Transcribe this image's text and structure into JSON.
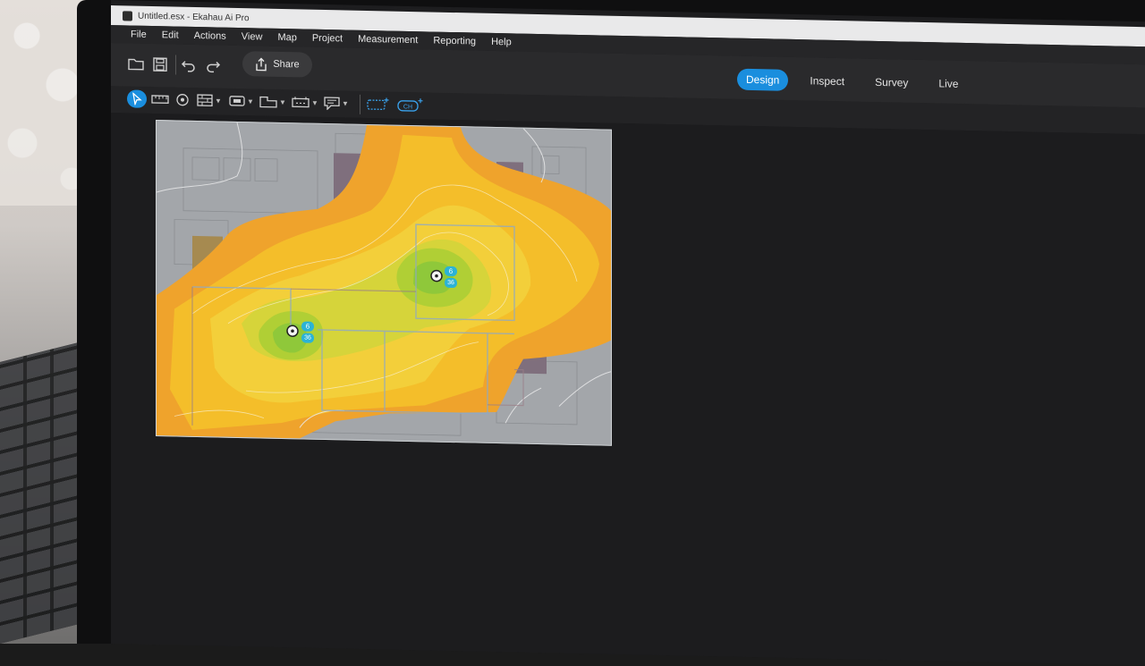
{
  "window": {
    "title": "Untitled.esx - Ekahau Ai Pro"
  },
  "menu": {
    "items": [
      "File",
      "Edit",
      "Actions",
      "View",
      "Map",
      "Project",
      "Measurement",
      "Reporting",
      "Help"
    ]
  },
  "toolbar": {
    "share_label": "Share",
    "modes": [
      {
        "label": "Design",
        "active": true
      },
      {
        "label": "Inspect",
        "active": false
      },
      {
        "label": "Survey",
        "active": false
      },
      {
        "label": "Live",
        "active": false
      }
    ]
  },
  "map": {
    "access_points": [
      {
        "channel_24": "6",
        "channel_5": "36"
      },
      {
        "channel_24": "6",
        "channel_5": "36"
      }
    ]
  },
  "colors": {
    "accent": "#1a8ede",
    "ap_badge": "#2bb3d6",
    "heat_strong": "#8fcf3a",
    "heat_mid": "#f2c22c",
    "heat_weak": "#f0a22a"
  }
}
